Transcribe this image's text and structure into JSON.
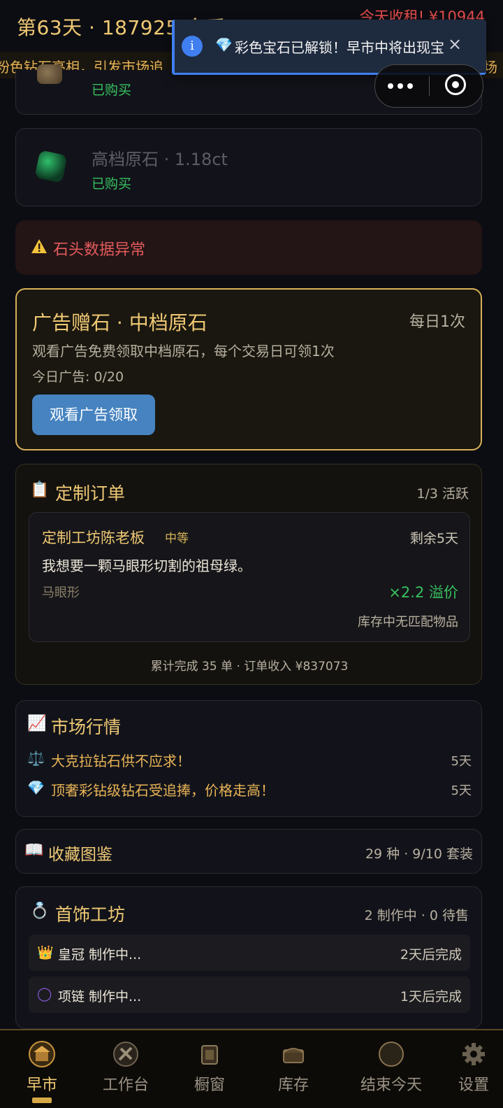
{
  "header": {
    "day_title": "第63天 · 187925",
    "day_title_overflow": "金币",
    "income": "今天收租! ¥10944",
    "ticker": "粉色钻石亮相，引发市场追",
    "ticker_tail": "场"
  },
  "toast": {
    "icon": "info-icon",
    "gem": "💎",
    "message": "彩色宝石已解锁！早市中将出现宝",
    "close": "×"
  },
  "stones": [
    {
      "name": "",
      "status": "已购买"
    },
    {
      "name": "高档原石 · 1.18ct",
      "status": "已购买"
    }
  ],
  "warning": {
    "text": "石头数据异常"
  },
  "ad_offer": {
    "title": "广告赠石 · 中档原石",
    "limit": "每日1次",
    "description": "观看广告免费领取中档原石，每个交易日可领1次",
    "count": "今日广告: 0/20",
    "button": "观看广告领取"
  },
  "orders": {
    "icon": "📋",
    "title": "定制订单",
    "active": "1/3 活跃",
    "item": {
      "customer": "定制工坊陈老板",
      "tier": "中等",
      "remaining": "剩余5天",
      "message": "我想要一颗马眼形切割的祖母绿。",
      "shape": "马眼形",
      "premium": "×2.2 溢价",
      "stock_status": "库存中无匹配物品"
    },
    "summary": "累计完成 35 单 · 订单收入 ¥837073"
  },
  "market": {
    "icon": "📈",
    "title": "市场行情",
    "items": [
      {
        "icon": "⚖️",
        "text": "大克拉钻石供不应求！",
        "days": "5天"
      },
      {
        "icon": "💎",
        "text": "顶奢彩钻级钻石受追捧，价格走高！",
        "days": "5天"
      }
    ]
  },
  "album": {
    "icon": "📖",
    "title": "收藏图鉴",
    "meta": "29 种 · 9/10 套装"
  },
  "workshop": {
    "icon": "💍",
    "title": "首饰工坊",
    "meta": "2 制作中 · 0 待售",
    "items": [
      {
        "icon": "👑",
        "text": "皇冠 制作中...",
        "eta": "2天后完成"
      },
      {
        "icon": "◯",
        "text": "项链 制作中...",
        "eta": "1天后完成"
      }
    ]
  },
  "nav": {
    "items": [
      {
        "label": "早市",
        "icon": "market-icon",
        "active": true
      },
      {
        "label": "工作台",
        "icon": "workbench-icon"
      },
      {
        "label": "橱窗",
        "icon": "showcase-icon"
      },
      {
        "label": "库存",
        "icon": "inventory-icon"
      },
      {
        "label": "结束今天",
        "icon": "end-day-icon"
      },
      {
        "label": "设置",
        "icon": "gear-icon"
      }
    ]
  },
  "colors": {
    "accent": "#f0c974",
    "success": "#37c25f",
    "danger": "#e35b5b",
    "button": "#4683c0"
  }
}
